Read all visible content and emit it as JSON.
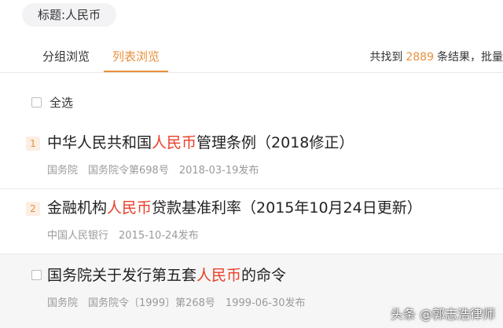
{
  "filter": {
    "label": "标题:人民币"
  },
  "tabs": [
    {
      "label": "分组浏览",
      "active": false
    },
    {
      "label": "列表浏览",
      "active": true
    }
  ],
  "results_summary": {
    "prefix": "共找到",
    "count": "2889",
    "suffix": "条结果，批量"
  },
  "select_all": {
    "label": "全选"
  },
  "items": [
    {
      "index": "1",
      "title_before": "中华人民共和国",
      "title_highlight": "人民币",
      "title_after": "管理条例（2018修正）",
      "meta": [
        "国务院",
        "国务院令第698号",
        "2018-03-19发布"
      ]
    },
    {
      "index": "2",
      "title_before": "金融机构",
      "title_highlight": "人民币",
      "title_after": "贷款基准利率（2015年10月24日更新）",
      "meta": [
        "中国人民银行",
        "2015-10-24发布"
      ]
    },
    {
      "index": "",
      "title_before": "国务院关于发行第五套",
      "title_highlight": "人民币",
      "title_after": "的命令",
      "meta": [
        "国务院",
        "国务院令〔1999〕第268号",
        "1999-06-30发布"
      ]
    }
  ],
  "watermark": {
    "text": "头条 @郭志浩律师"
  },
  "colors": {
    "accent": "#e8903b",
    "highlight": "#e8402a",
    "meta": "#9a9a9a"
  }
}
